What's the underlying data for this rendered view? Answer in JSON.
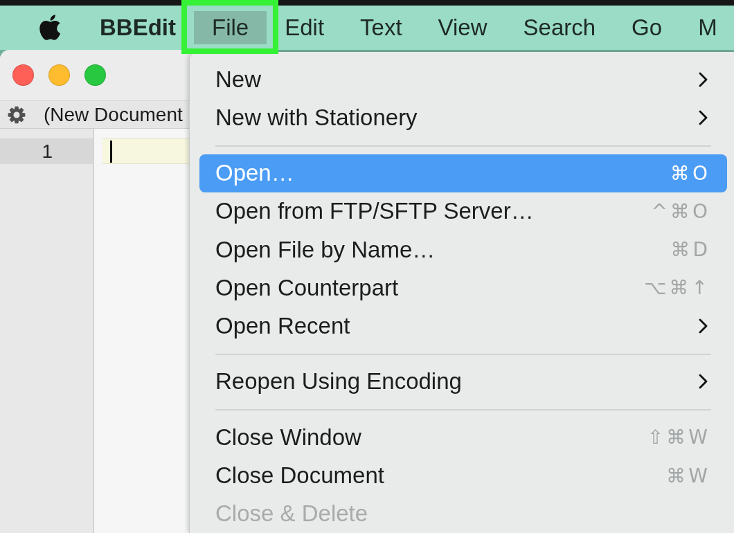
{
  "menubar": {
    "items": [
      {
        "kind": "app",
        "label": "BBEdit",
        "selected": false,
        "annotated": false
      },
      {
        "kind": "menu",
        "label": "File",
        "selected": true,
        "annotated": true
      },
      {
        "kind": "menu",
        "label": "Edit",
        "selected": false,
        "annotated": false
      },
      {
        "kind": "menu",
        "label": "Text",
        "selected": false,
        "annotated": false
      },
      {
        "kind": "menu",
        "label": "View",
        "selected": false,
        "annotated": false
      },
      {
        "kind": "menu",
        "label": "Search",
        "selected": false,
        "annotated": false
      },
      {
        "kind": "menu",
        "label": "Go",
        "selected": false,
        "annotated": false
      },
      {
        "kind": "menu",
        "label": "M",
        "selected": false,
        "annotated": false
      }
    ]
  },
  "window": {
    "title": "(New Document",
    "line_numbers": [
      {
        "label": "1",
        "current": true
      }
    ]
  },
  "menu": {
    "items": [
      {
        "kind": "item",
        "label": "New",
        "submenu": true,
        "selected": false,
        "disabled": false
      },
      {
        "kind": "item",
        "label": "New with Stationery",
        "submenu": true,
        "selected": false,
        "disabled": false
      },
      {
        "kind": "separator"
      },
      {
        "kind": "item",
        "label": "Open…",
        "shortcut": "⌘O",
        "submenu": false,
        "selected": true,
        "disabled": false
      },
      {
        "kind": "item",
        "label": "Open from FTP/SFTP Server…",
        "shortcut": "^⌘O",
        "submenu": false,
        "selected": false,
        "disabled": false
      },
      {
        "kind": "item",
        "label": "Open File by Name…",
        "shortcut": "⌘D",
        "submenu": false,
        "selected": false,
        "disabled": false
      },
      {
        "kind": "item",
        "label": "Open Counterpart",
        "shortcut": "⌥⌘↑",
        "submenu": false,
        "selected": false,
        "disabled": false
      },
      {
        "kind": "item",
        "label": "Open Recent",
        "submenu": true,
        "selected": false,
        "disabled": false
      },
      {
        "kind": "separator"
      },
      {
        "kind": "item",
        "label": "Reopen Using Encoding",
        "submenu": true,
        "selected": false,
        "disabled": false
      },
      {
        "kind": "separator"
      },
      {
        "kind": "item",
        "label": "Close Window",
        "shortcut": "⇧⌘W",
        "submenu": false,
        "selected": false,
        "disabled": false
      },
      {
        "kind": "item",
        "label": "Close Document",
        "shortcut": "⌘W",
        "submenu": false,
        "selected": false,
        "disabled": false
      },
      {
        "kind": "item",
        "label": "Close & Delete",
        "submenu": false,
        "selected": false,
        "disabled": true
      }
    ]
  }
}
